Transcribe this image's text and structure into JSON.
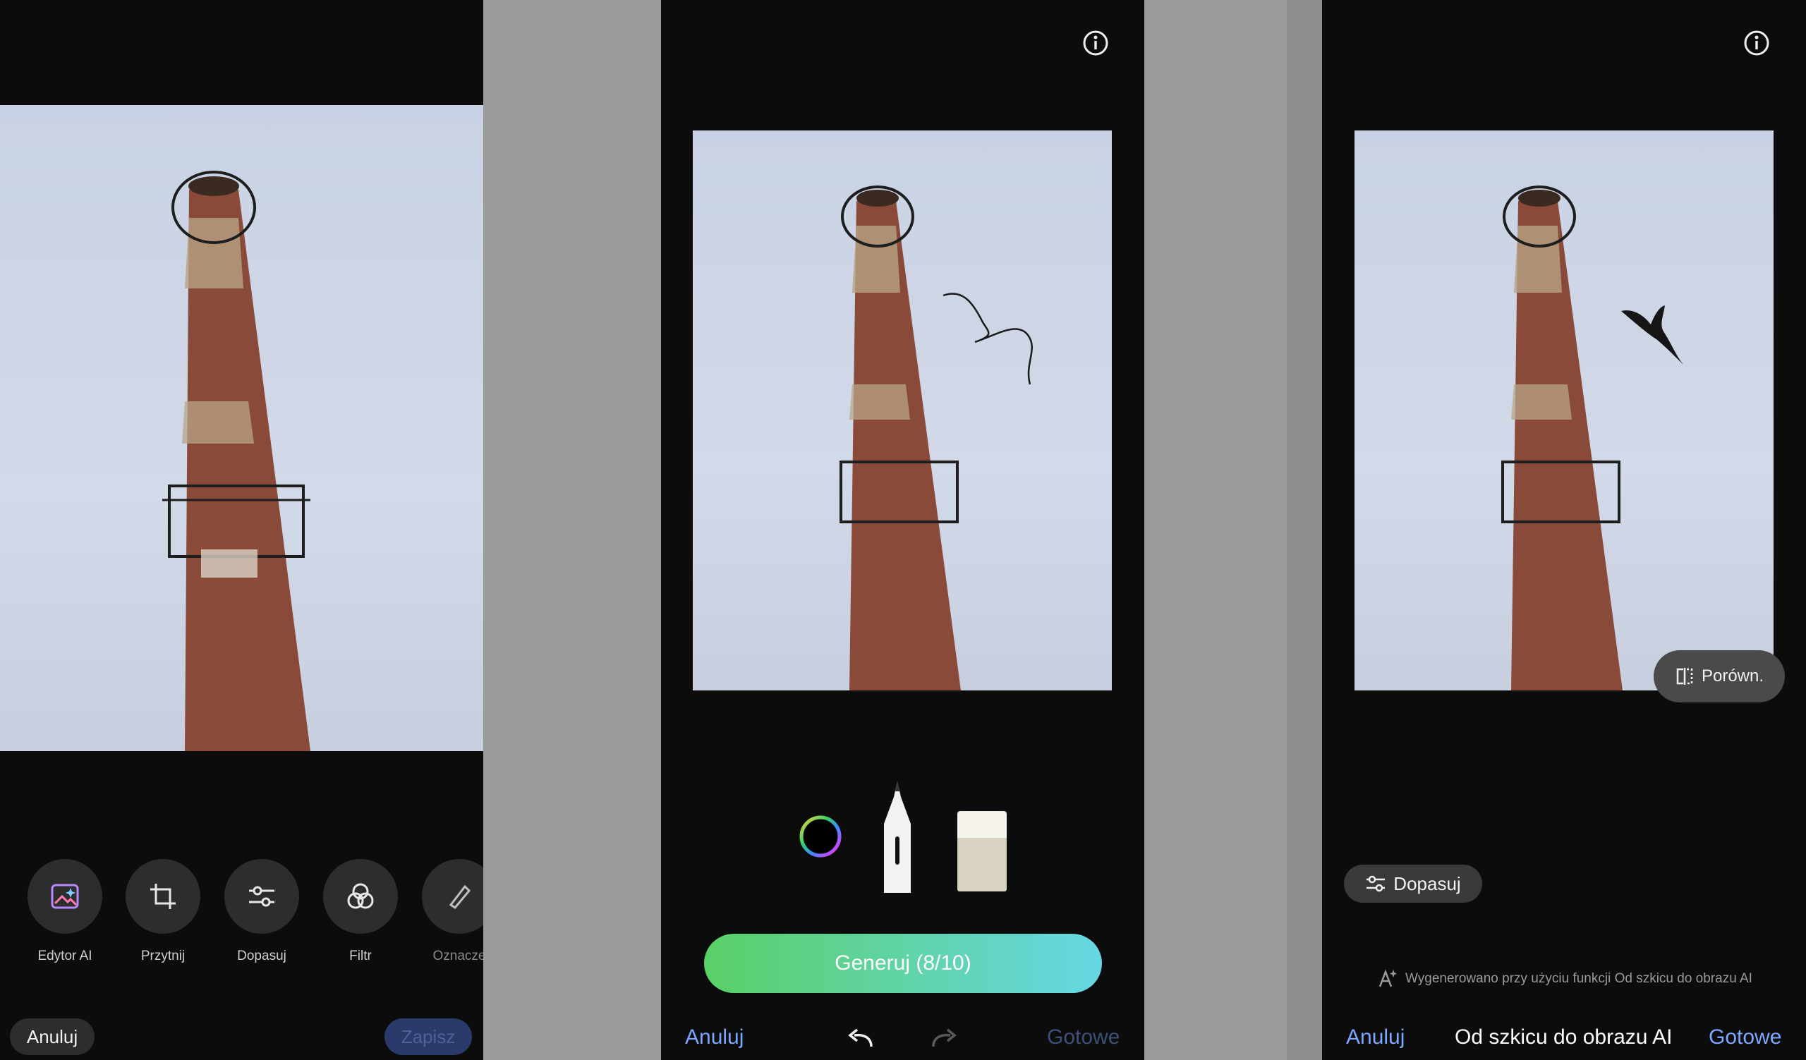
{
  "colors": {
    "panel_bg": "#0c0c0c",
    "accent_blue": "#7ba7ff",
    "disabled_blue": "#3e4f7a",
    "generate_gradient_start": "#5ad066",
    "generate_gradient_end": "#66d6e4"
  },
  "panel1": {
    "tools": [
      {
        "label": "Edytor AI",
        "icon": "ai-editor-icon"
      },
      {
        "label": "Przytnij",
        "icon": "crop-icon"
      },
      {
        "label": "Dopasuj",
        "icon": "adjust-sliders-icon"
      },
      {
        "label": "Filtr",
        "icon": "filter-circles-icon"
      },
      {
        "label": "Oznacze",
        "icon": "markup-pen-icon"
      }
    ],
    "cancel_label": "Anuluj",
    "save_label": "Zapisz"
  },
  "panel2": {
    "info_icon": "info-icon",
    "generate_label": "Generuj (8/10)",
    "cancel_label": "Anuluj",
    "done_label": "Gotowe",
    "tools": [
      "color-picker-icon",
      "pen-tool-icon",
      "eraser-tool-icon"
    ]
  },
  "panel3": {
    "info_icon": "info-icon",
    "compare_label": "Porówn.",
    "adjust_label": "Dopasuj",
    "generated_note": "Wygenerowano przy użyciu funkcji Od szkicu do obrazu AI",
    "cancel_label": "Anuluj",
    "title": "Od szkicu do obrazu AI",
    "done_label": "Gotowe"
  }
}
